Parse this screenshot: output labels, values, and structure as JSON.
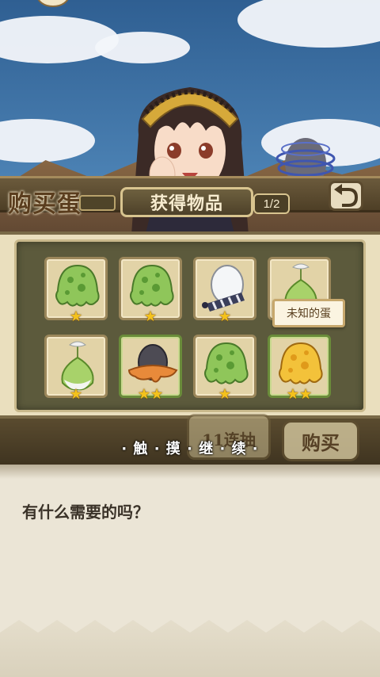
{
  "shop": {
    "title": "购买蛋",
    "buy_label": "购买",
    "ten_pull_label": "11连抽"
  },
  "modal": {
    "title": "获得物品",
    "page": "1/2",
    "continue_hint": "· 触 · 摸 · 继 · 续 ·",
    "tooltip": "未知的蛋"
  },
  "items": [
    {
      "name": "green-slime-egg",
      "stars": "★",
      "rarity": 1
    },
    {
      "name": "green-slime-egg",
      "stars": "★",
      "rarity": 1
    },
    {
      "name": "white-striped-egg",
      "stars": "★",
      "rarity": 1
    },
    {
      "name": "sprout-egg",
      "stars": "★",
      "rarity": 1
    },
    {
      "name": "sprout-egg",
      "stars": "★",
      "rarity": 1
    },
    {
      "name": "dark-egg-orange-wrap",
      "stars": "★★",
      "rarity": 2
    },
    {
      "name": "green-slime-egg",
      "stars": "★",
      "rarity": 1
    },
    {
      "name": "golden-slime-egg",
      "stars": "★★",
      "rarity": 2
    }
  ],
  "dialogue": {
    "text": "有什么需要的吗？"
  },
  "colors": {
    "panel": "#5c5a3c",
    "slot": "#e2d3a7",
    "star": "#f4c21c",
    "rare_border": "#6a8c3a"
  }
}
